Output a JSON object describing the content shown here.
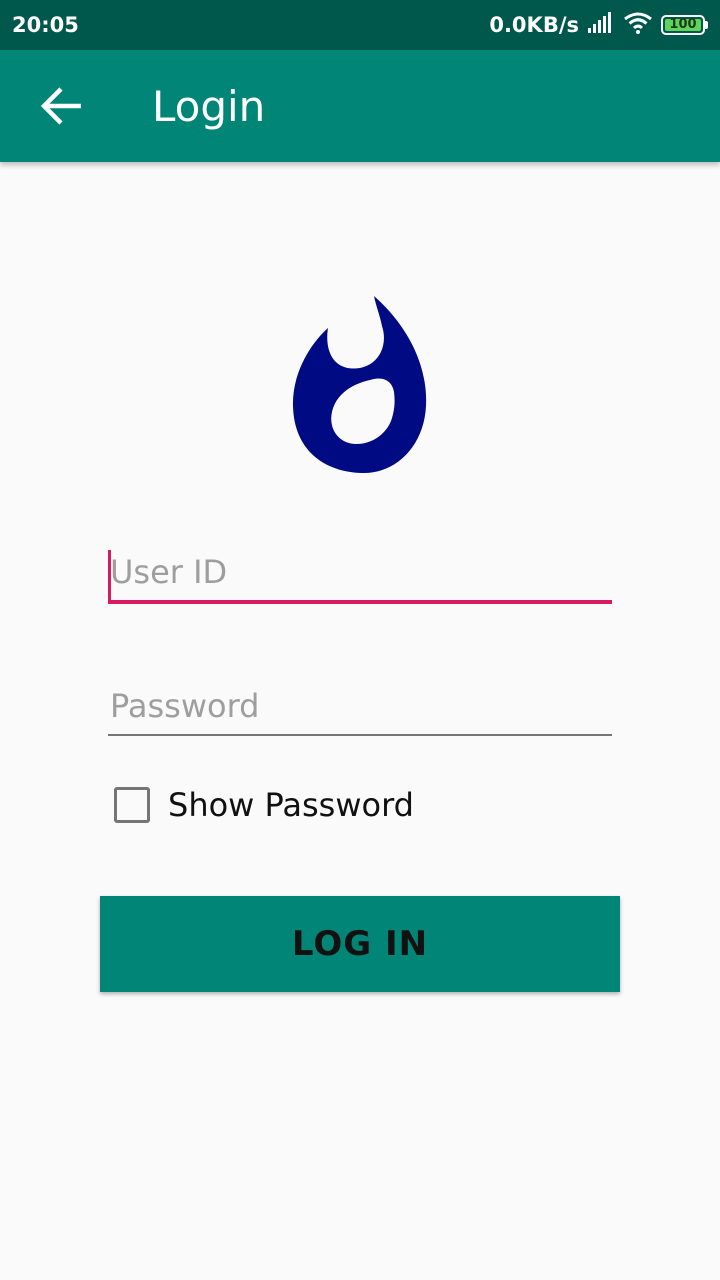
{
  "status_bar": {
    "time": "20:05",
    "network_speed": "0.0KB/s",
    "battery": "100",
    "icons": [
      "signal-icon",
      "wifi-icon",
      "battery-icon"
    ]
  },
  "app_bar": {
    "title": "Login",
    "back_icon": "arrow-back-icon"
  },
  "logo": {
    "icon": "flame-logo-icon",
    "color": "#000a82"
  },
  "form": {
    "user_id": {
      "value": "",
      "placeholder": "User ID"
    },
    "password": {
      "value": "",
      "placeholder": "Password"
    },
    "show_password": {
      "label": "Show Password",
      "checked": false
    },
    "login_button": "LOG IN"
  },
  "colors": {
    "primary": "#008577",
    "primary_dark": "#00574b",
    "accent": "#d81b60",
    "background": "#fafafa"
  }
}
